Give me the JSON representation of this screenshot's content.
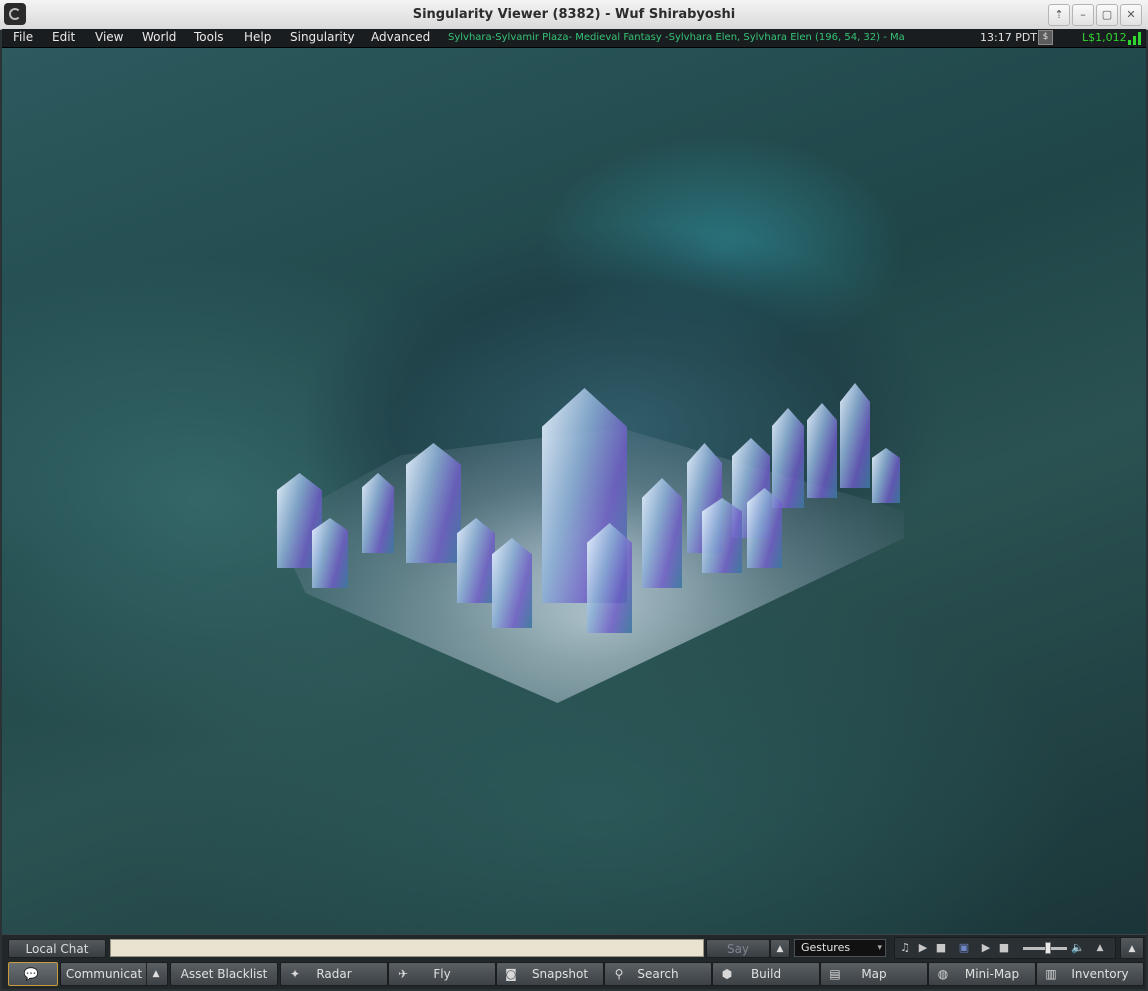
{
  "window": {
    "title": "Singularity Viewer (8382) - Wuf Shirabyoshi",
    "controls": [
      "⇡",
      "–",
      "▢",
      "✕"
    ]
  },
  "menubar": {
    "items": [
      "File",
      "Edit",
      "View",
      "World",
      "Tools",
      "Help",
      "Singularity",
      "Advanced"
    ],
    "location": "Sylvhara-Sylvamir Plaza- Medieval Fantasy -Sylvhara Elen, Sylvhara Elen (196, 54, 32) - Ma",
    "clock": "13:17 PDT",
    "buy_icon": "$",
    "balance": "L$1,012"
  },
  "chatbar": {
    "local_chat_label": "Local Chat",
    "chat_input_value": "",
    "say_label": "Say",
    "history_caret": "▲",
    "gestures_label": "Gestures",
    "gestures_caret": "▾",
    "expand_caret": "▲"
  },
  "toolbar": {
    "communicate_label": "Communicat",
    "communicate_caret": "▲",
    "asset_blacklist_label": "Asset Blacklist",
    "radar_label": "Radar",
    "fly_label": "Fly",
    "snapshot_label": "Snapshot",
    "search_label": "Search",
    "build_label": "Build",
    "map_label": "Map",
    "minimap_label": "Mini-Map",
    "inventory_label": "Inventory"
  },
  "colors": {
    "location_text": "#35c277",
    "balance_text": "#2fd62f",
    "chat_input_bg": "#e9e4cf",
    "chat_toggle_border": "#c79a3a"
  }
}
